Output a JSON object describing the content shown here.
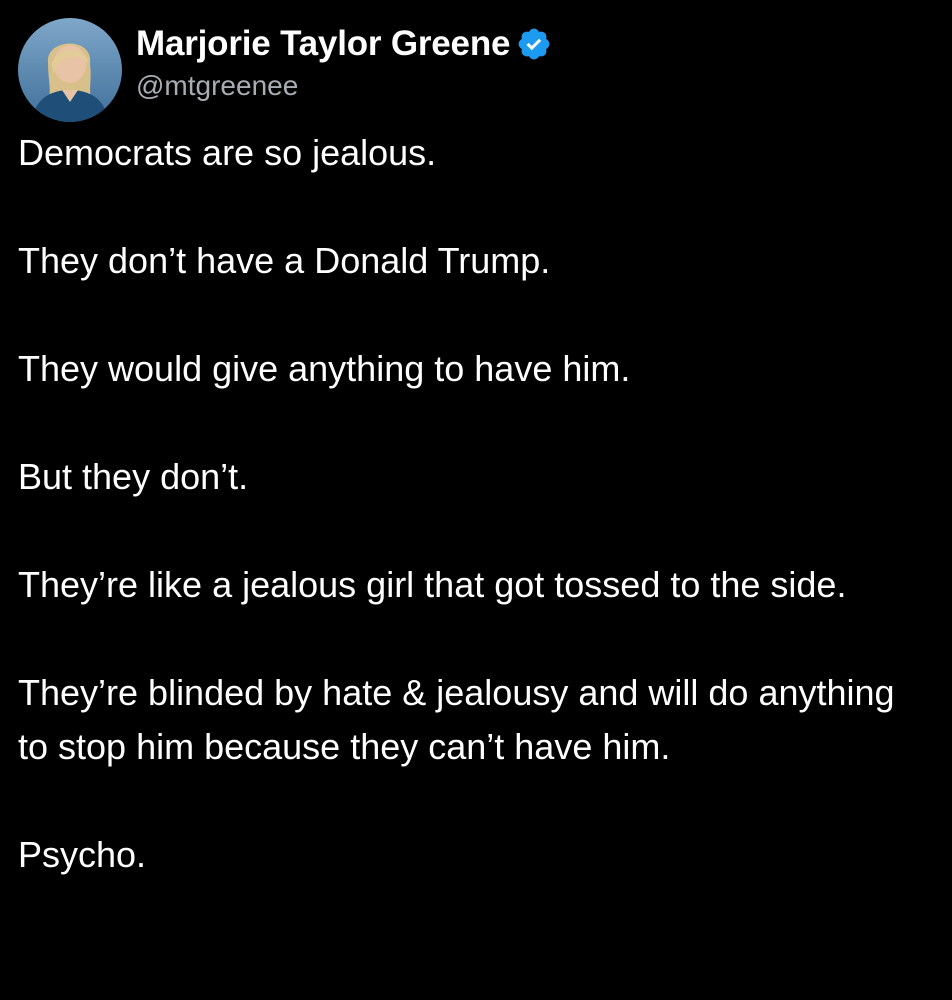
{
  "tweet": {
    "author": {
      "display_name": "Marjorie Taylor Greene",
      "handle": "@mtgreenee",
      "verified": true,
      "verified_icon": "verified-badge-icon",
      "verified_color": "#1d9bf0",
      "avatar": "profile-photo"
    },
    "paragraphs": [
      "Democrats are so jealous.",
      "They don’t have a Donald Trump.",
      "They would give anything to have him.",
      "But they don’t.",
      "They’re like a jealous girl that got tossed to the side.",
      "They’re blinded by hate & jealousy and will do anything to stop him because they can’t have him.",
      "Psycho."
    ]
  },
  "colors": {
    "background": "#000000",
    "text": "#ffffff",
    "handle": "#a8adb3"
  }
}
